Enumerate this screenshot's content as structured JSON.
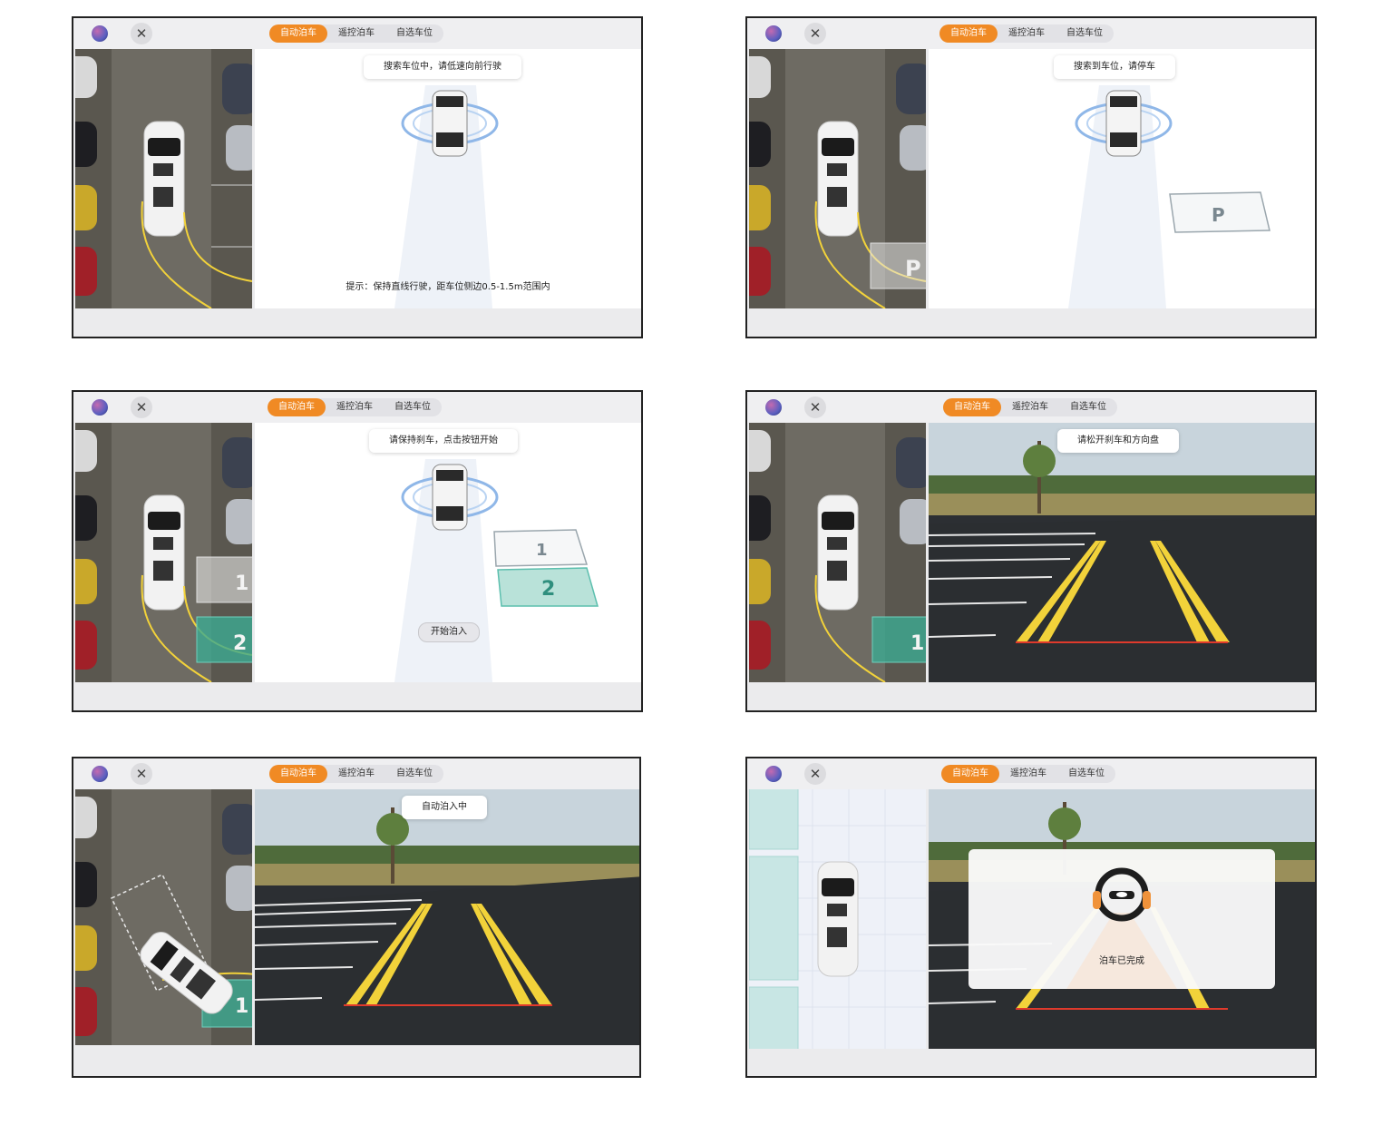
{
  "tabs": [
    "自动泊车",
    "遥控泊车",
    "自选车位"
  ],
  "icons": {
    "close": "close-icon",
    "logo": "app-logo-icon",
    "wheel": "steering-wheel-icon"
  },
  "colors": {
    "accent": "#f08a24",
    "slot_teal": "#5cbfae",
    "guide_yellow": "#f2d23a"
  },
  "screens": [
    {
      "message": "搜索车位中，请低速向前行驶",
      "hint": "提示：保持直线行驶，距车位侧边0.5-1.5m范围内"
    },
    {
      "message": "搜索到车位，请停车",
      "slot_label": "P"
    },
    {
      "message": "请保持刹车，点击按钮开始",
      "slot_1": "1",
      "slot_2": "2",
      "start_button": "开始泊入"
    },
    {
      "message": "请松开刹车和方向盘",
      "slot_label": "1"
    },
    {
      "message": "自动泊入中",
      "slot_label": "1"
    },
    {
      "message": "泊车已完成"
    }
  ]
}
